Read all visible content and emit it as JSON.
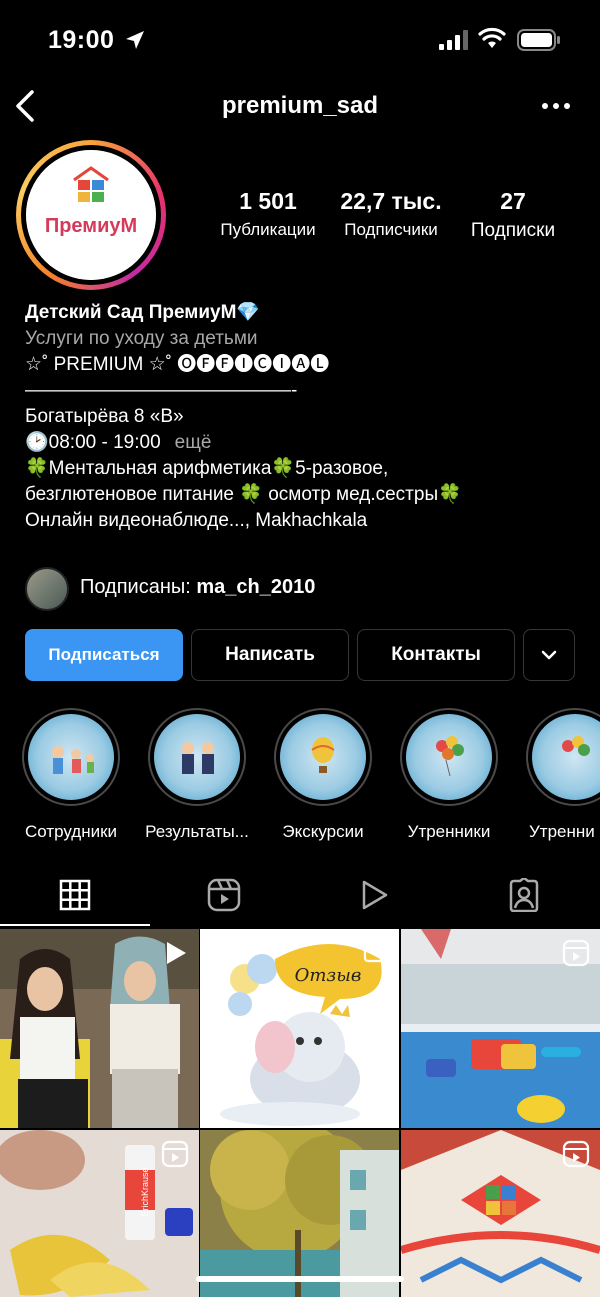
{
  "status_bar": {
    "time": "19:00"
  },
  "header": {
    "username": "premium_sad"
  },
  "profile": {
    "avatar_logo_text": "ПремиуМ",
    "stats": [
      {
        "value": "1 501",
        "label": "Публикации"
      },
      {
        "value": "22,7 тыс.",
        "label": "Подписчики"
      },
      {
        "value": "27",
        "label": "Подписки"
      }
    ],
    "bio": {
      "name": "Детский Сад ПремиуМ💎",
      "category": "Услуги по уходу за детьми",
      "line1": "☆˚ PREMIUM ☆˚ 🅞🅕🅕🅘🅒🅘🅐🅛",
      "divider": "——————————————-",
      "address": "Богатырёва 8 «В»",
      "hours": "🕑08:00 - 19:00",
      "more": "ещё",
      "line_a": "🍀Ментальная арифметика🍀5-разовое,",
      "line_b": "безглютеновое питание 🍀 осмотр мед.сестры🍀",
      "line_c": "Онлайн видеонаблюде..., Makhachkala"
    },
    "followed_by": {
      "prefix": "Подписаны: ",
      "user": "ma_ch_2010"
    }
  },
  "actions": {
    "follow": "Подписаться",
    "message": "Написать",
    "contacts": "Контакты"
  },
  "highlights": [
    {
      "label": "Сотрудники"
    },
    {
      "label": "Результаты..."
    },
    {
      "label": "Экскурсии"
    },
    {
      "label": "Утренники"
    },
    {
      "label": "Утренни"
    }
  ],
  "tabs": [
    "grid-icon",
    "reels-icon",
    "video-icon",
    "tagged-icon"
  ],
  "grid_posts": [
    {
      "type": "video",
      "scene": "two women seated"
    },
    {
      "type": "multi",
      "scene": "elephant illustration",
      "text": "Отзыв"
    },
    {
      "type": "reel",
      "scene": "kids pool with toys"
    },
    {
      "type": "reel",
      "scene": "crafts with leaves and glue stick",
      "text": "ErichKrause"
    },
    {
      "type": "none",
      "scene": "autumn tree and building"
    },
    {
      "type": "reel",
      "scene": "colorful cake close-up"
    }
  ],
  "colors": {
    "follow_button": "#3b96f3",
    "background": "#000000",
    "muted_text": "#a8a8a8"
  }
}
